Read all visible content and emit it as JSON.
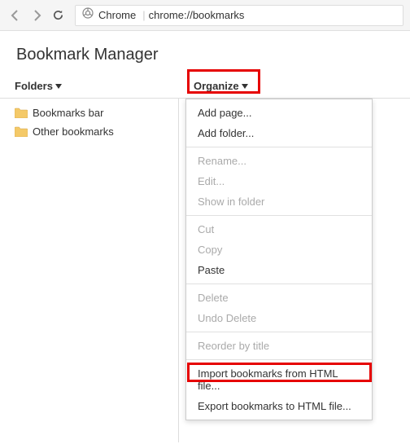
{
  "browser": {
    "protocol_label": "Chrome",
    "url": "chrome://bookmarks"
  },
  "page": {
    "title": "Bookmark Manager"
  },
  "toolbar": {
    "folders_label": "Folders",
    "organize_label": "Organize"
  },
  "sidebar": {
    "items": [
      {
        "label": "Bookmarks bar"
      },
      {
        "label": "Other bookmarks"
      }
    ]
  },
  "menu": {
    "add_page": "Add page...",
    "add_folder": "Add folder...",
    "rename": "Rename...",
    "edit": "Edit...",
    "show_in_folder": "Show in folder",
    "cut": "Cut",
    "copy": "Copy",
    "paste": "Paste",
    "delete": "Delete",
    "undo_delete": "Undo Delete",
    "reorder": "Reorder by title",
    "import_html": "Import bookmarks from HTML file...",
    "export_html": "Export bookmarks to HTML file..."
  }
}
